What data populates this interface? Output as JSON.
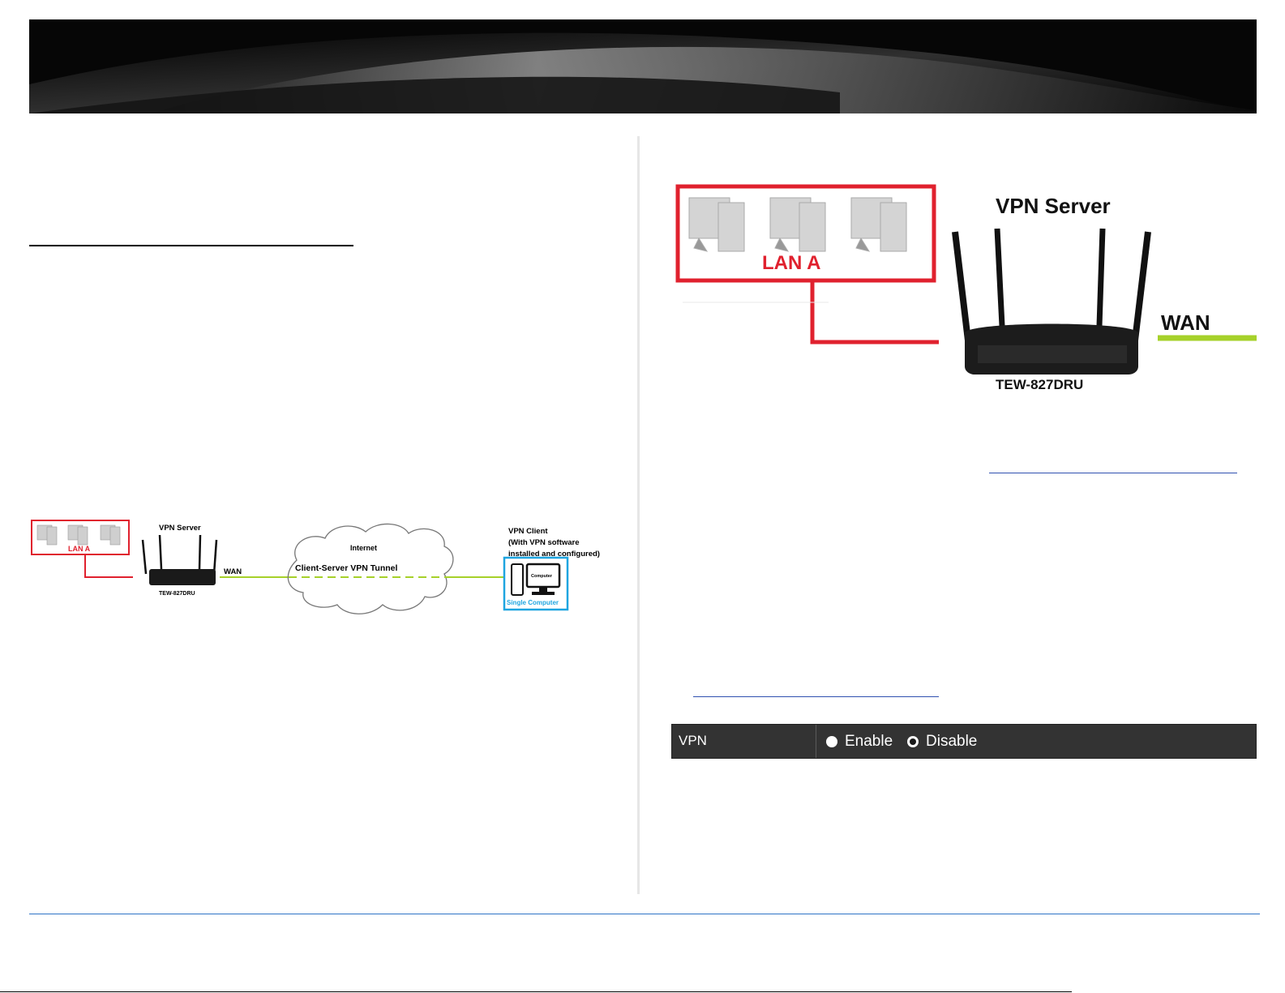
{
  "small_diagram": {
    "lan_label": "LAN A",
    "server_label": "VPN Server",
    "router_model": "TEW-827DRU",
    "wan_label": "WAN",
    "internet_label": "Internet",
    "tunnel_label": "Client-Server VPN Tunnel",
    "client_line1": "VPN Client",
    "client_line2": "(With VPN software",
    "client_line3": "installed and configured)",
    "computer_label": "Computer",
    "single_computer_label": "Single Computer"
  },
  "large_diagram": {
    "lan_label": "LAN A",
    "server_label": "VPN Server",
    "wan_label": "WAN",
    "router_model": "TEW-827DRU"
  },
  "vpn_setting": {
    "label": "VPN",
    "enable_label": "Enable",
    "disable_label": "Disable",
    "selected": "Disable"
  },
  "colors": {
    "lan_red": "#e0212e",
    "wan_green": "#a6d12a",
    "client_blue": "#1ea5e0",
    "footer_blue": "#2e74c6"
  }
}
